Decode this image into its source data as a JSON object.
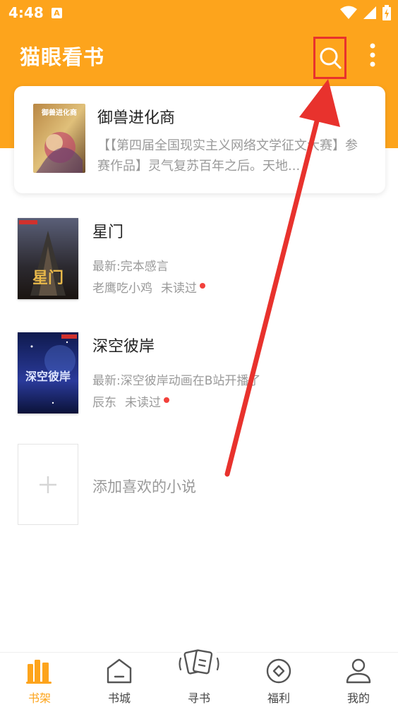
{
  "status_bar": {
    "time": "4:48",
    "notification_letter": "A"
  },
  "app": {
    "title": "猫眼看书"
  },
  "featured": {
    "title": "御兽进化商",
    "cover_text": "御兽进化商",
    "description": "【【第四届全国现实主义网络文学征文大赛】参赛作品】灵气复苏百年之后。天地..."
  },
  "books": [
    {
      "title": "星门",
      "cover_text": "星门",
      "latest": "最新:完本感言",
      "author": "老鹰吃小鸡",
      "status": "未读过"
    },
    {
      "title": "深空彼岸",
      "cover_text": "深空彼岸",
      "latest": "最新:深空彼岸动画在B站开播了",
      "author": "辰东",
      "status": "未读过"
    }
  ],
  "add_novel": {
    "label": "添加喜欢的小说"
  },
  "tabs": [
    {
      "label": "书架",
      "icon": "bookshelf-icon",
      "active": true
    },
    {
      "label": "书城",
      "icon": "bookstore-icon",
      "active": false
    },
    {
      "label": "寻书",
      "icon": "find-book-icon",
      "active": false
    },
    {
      "label": "福利",
      "icon": "coin-icon",
      "active": false
    },
    {
      "label": "我的",
      "icon": "profile-icon",
      "active": false
    }
  ],
  "colors": {
    "brand": "#fda41c",
    "unread_dot": "#f2413b",
    "annotation": "#e8322d"
  }
}
